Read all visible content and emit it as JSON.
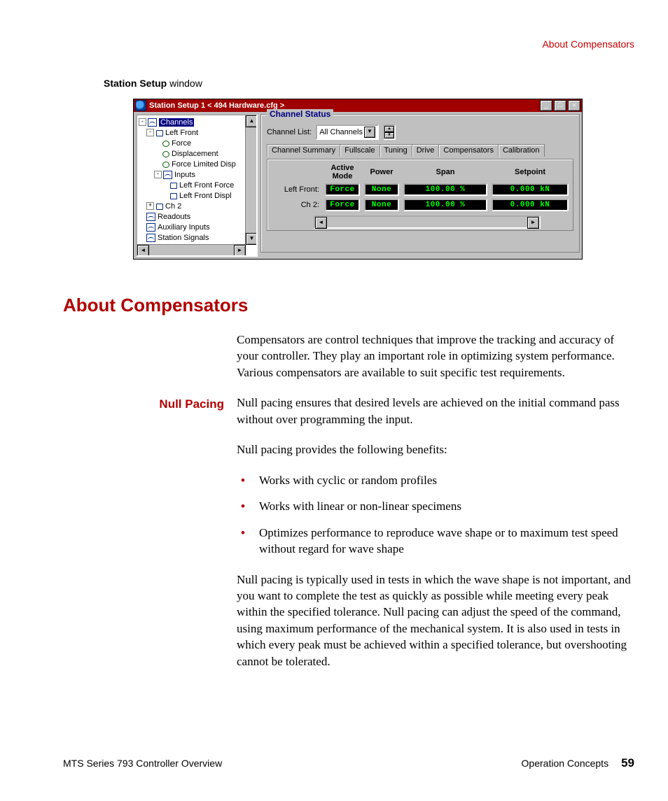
{
  "header_right": "About Compensators",
  "caption": {
    "bold": "Station Setup",
    "rest": " window"
  },
  "window": {
    "title": "Station Setup 1 < 494 Hardware.cfg >",
    "tree": {
      "root": "Channels",
      "items": [
        "Left Front",
        "Force",
        "Displacement",
        "Force Limited Disp",
        "Inputs",
        "Left Front Force",
        "Left Front Displ",
        "Ch 2",
        "Readouts",
        "Auxiliary Inputs",
        "Station Signals"
      ]
    },
    "group_label": "Channel Status",
    "chan_list_label": "Channel List:",
    "chan_list_value": "All Channels",
    "tabs": [
      "Channel Summary",
      "Fullscale",
      "Tuning",
      "Drive",
      "Compensators",
      "Calibration"
    ],
    "columns": {
      "c1": "Active Mode",
      "c2": "Power",
      "c3": "Span",
      "c4": "Setpoint"
    },
    "rows": [
      {
        "label": "Left Front:",
        "mode": "Force",
        "power": "None",
        "span": "100.00 %",
        "setpoint": "0.000 kN"
      },
      {
        "label": "Ch 2:",
        "mode": "Force",
        "power": "None",
        "span": "100.00 %",
        "setpoint": "0.000 kN"
      }
    ]
  },
  "section_title": "About Compensators",
  "intro_para": "Compensators are control techniques that improve the tracking and accuracy of your controller. They play an important role in optimizing system performance. Various compensators are available to suit specific test requirements.",
  "null_pacing": {
    "side_title": "Null Pacing",
    "p1": "Null pacing ensures that desired levels are achieved on the initial command pass without over programming the input.",
    "p2": "Null pacing provides the following benefits:",
    "bullets": [
      "Works with cyclic or random profiles",
      "Works with linear or non-linear specimens",
      "Optimizes performance to reproduce wave shape or to maximum test speed without regard for wave shape"
    ],
    "p3": "Null pacing is typically used in tests in which the wave shape is not important, and you want to complete the test as quickly as possible while meeting every peak within the specified tolerance. Null pacing can adjust the speed of the command, using maximum performance of the mechanical system. It is also used in tests in which every peak must be achieved within a specified tolerance, but overshooting cannot be tolerated."
  },
  "footer": {
    "left": "MTS Series 793 Controller Overview",
    "right": "Operation Concepts",
    "page": "59"
  }
}
